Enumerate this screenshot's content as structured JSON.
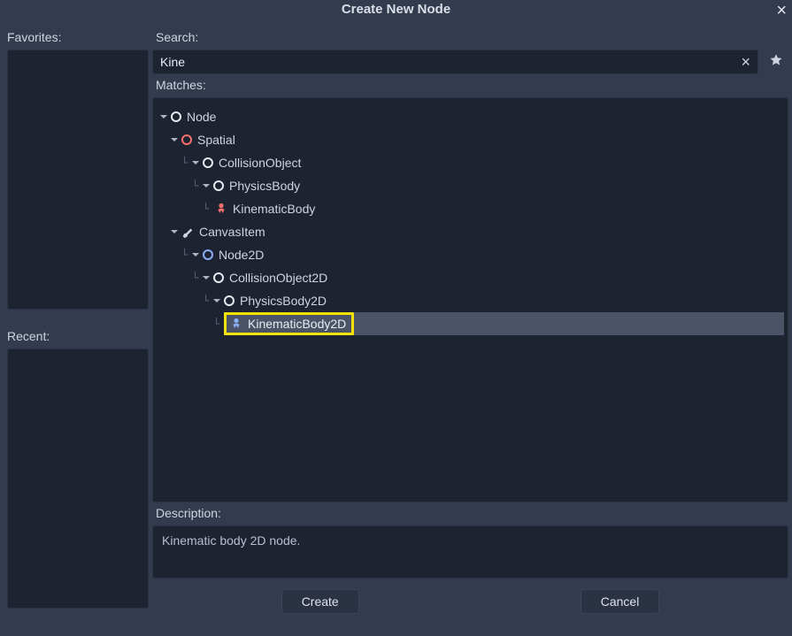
{
  "title": "Create New Node",
  "left": {
    "favorites_label": "Favorites:",
    "recent_label": "Recent:"
  },
  "right": {
    "search_label": "Search:",
    "search_value": "Kine",
    "matches_label": "Matches:",
    "description_label": "Description:",
    "description_text": "Kinematic body 2D node."
  },
  "tree": {
    "0": "Node",
    "1": "Spatial",
    "2": "CollisionObject",
    "3": "PhysicsBody",
    "4": "KinematicBody",
    "5": "CanvasItem",
    "6": "Node2D",
    "7": "CollisionObject2D",
    "8": "PhysicsBody2D",
    "9": "KinematicBody2D"
  },
  "footer": {
    "create": "Create",
    "cancel": "Cancel"
  },
  "colors": {
    "bg": "#333b4f",
    "panel": "#1d2331",
    "text": "#cdd3df",
    "highlight_border": "#f6e205",
    "selection_bg": "#4b5367",
    "spatial_red": "#f86f6c",
    "node2d_blue": "#8caef3"
  }
}
